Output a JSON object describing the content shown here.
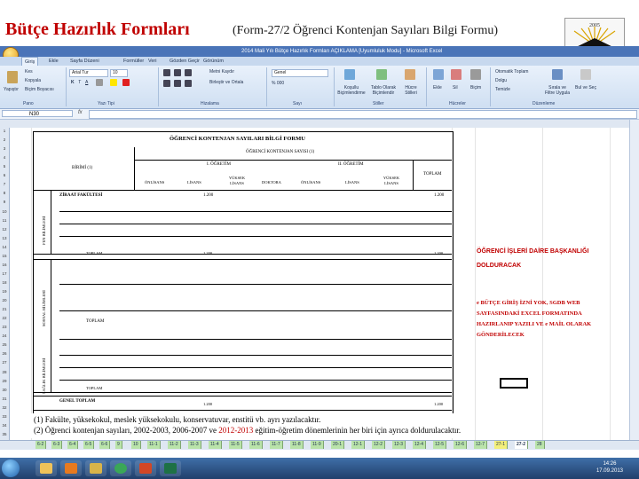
{
  "slide": {
    "title": "Bütçe Hazırlık Formları",
    "subtitle": "(Form-27/2 Öğrenci Kontenjan Sayıları Bilgi Formu)",
    "logo_text": "2005"
  },
  "excel": {
    "window_title": "2014 Mali Yılı Bütçe Hazırlık Formları AÇIKLAMA [Uyumluluk Modu] - Microsoft Excel",
    "tabs": [
      "Giriş",
      "Ekle",
      "Sayfa Düzeni",
      "Formüller",
      "Veri",
      "Gözden Geçir",
      "Görünüm"
    ],
    "active_tab": "Giriş",
    "ribbon": {
      "paste": "Yapıştır",
      "cut": "Kes",
      "copy": "Kopyala",
      "format_painter": "Biçim Boyacısı",
      "font_name": "Arial Tur",
      "font_size": "10",
      "wrap_text": "Metni Kaydır",
      "merge_center": "Birleştir ve Ortala",
      "number_format": "Genel",
      "conditional_format": "Koşullu Biçimlendirme",
      "format_as_table": "Tablo Olarak Biçimlendir",
      "cell_styles": "Hücre Stilleri",
      "insert": "Ekle",
      "delete": "Sil",
      "format": "Biçim",
      "autosum": "Otomatik Toplam",
      "fill": "Dolgu",
      "clear": "Temizle",
      "sort_filter": "Sırala ve Filtre Uygula",
      "find_select": "Bul ve Seç",
      "groups": [
        "Pano",
        "Yazı Tipi",
        "Hizalama",
        "Sayı",
        "Stiller",
        "Hücreler",
        "Düzenleme"
      ]
    },
    "name_box": "N30",
    "fx": "fx",
    "row_numbers": [
      "1",
      "2",
      "3",
      "4",
      "5",
      "6",
      "7",
      "8",
      "9",
      "10",
      "11",
      "12",
      "13",
      "14",
      "15",
      "16",
      "17",
      "18",
      "19",
      "20",
      "21",
      "22",
      "23",
      "24",
      "25",
      "26",
      "27",
      "28",
      "29",
      "30",
      "31",
      "32",
      "33",
      "34",
      "35"
    ],
    "sheet_tabs": [
      "6-2",
      "6-3",
      "6-4",
      "6-5",
      "6-6",
      "9",
      "10",
      "11-1",
      "11-2",
      "11-3",
      "11-4",
      "11-5",
      "11-6",
      "11-7",
      "11-8",
      "11-9",
      "20-1",
      "12-1",
      "12-2",
      "12-3",
      "12-4",
      "12-5",
      "12-6",
      "12-7",
      "27-1",
      "27-2",
      "28"
    ],
    "active_sheet": "27-2"
  },
  "form": {
    "heading": "ÖĞRENCİ KONTENJAN SAYILARI BİLGİ FORMU",
    "subheading": "ÖĞRENCİ KONTENJAN SAYISI (1)",
    "unit_label": "BİRİMİ (1)",
    "first_teaching": "I. ÖĞRETİM",
    "second_teaching": "II. ÖĞRETİM",
    "total": "TOPLAM",
    "columns": [
      "ÖNLİSANS",
      "LİSANS",
      "YÜKSEK LİSANS",
      "DOKTORA",
      "ÖNLİSANS",
      "LİSANS",
      "YÜKSEK LİSANS"
    ],
    "faculty": "ZİRAAT FAKÜLTESİ",
    "faculty_value": "1.200",
    "faculty_total": "1.200",
    "section_science": "FEN BİLİMLERİ",
    "section_social": "SOSYAL BİLİMLERİ",
    "section_health": "SAĞLIK BİLİMLERİ",
    "sub_total_label": "TOPLAM",
    "sub_total_value": "1.200",
    "sub_total_total": "1.200",
    "grand_total_label": "GENEL TOPLAM",
    "grand_total_value": "1.200",
    "grand_total_total": "1.200"
  },
  "notes": {
    "note1": "(1) Fakülte, yüksekokul, meslek yüksekokulu, konservatuvar, enstitü vb. ayrı yazılacaktır.",
    "note2_a": "(2) Öğrenci kontenjan sayıları, 2002-2003, 2006-2007 ve ",
    "note2_red": "2012-2013",
    "note2_b": " eğitim-öğretim dönemlerinin her biri için ayrıca doldurulacaktır."
  },
  "side_notes": {
    "line1": "ÖĞRENCİ İŞLERİ DAİRE BAŞKANLIĞI",
    "line2": "DOLDURACAK",
    "line3": "e BÜTÇE GİRİŞ İZNİ YOK, SGDB WEB",
    "line4": "SAYFASINDAKİ EXCEL FORMATINDA",
    "line5": "HAZIRLANIP YAZILI VE e MAİL OLARAK",
    "line6": "GÖNDERİLECEK"
  },
  "taskbar": {
    "time": "14:26",
    "date": "17.09.2013"
  },
  "colors": {
    "title_red": "#c00000",
    "excel_blue": "#4a74b8",
    "tab_green": "#b9e3a9"
  }
}
